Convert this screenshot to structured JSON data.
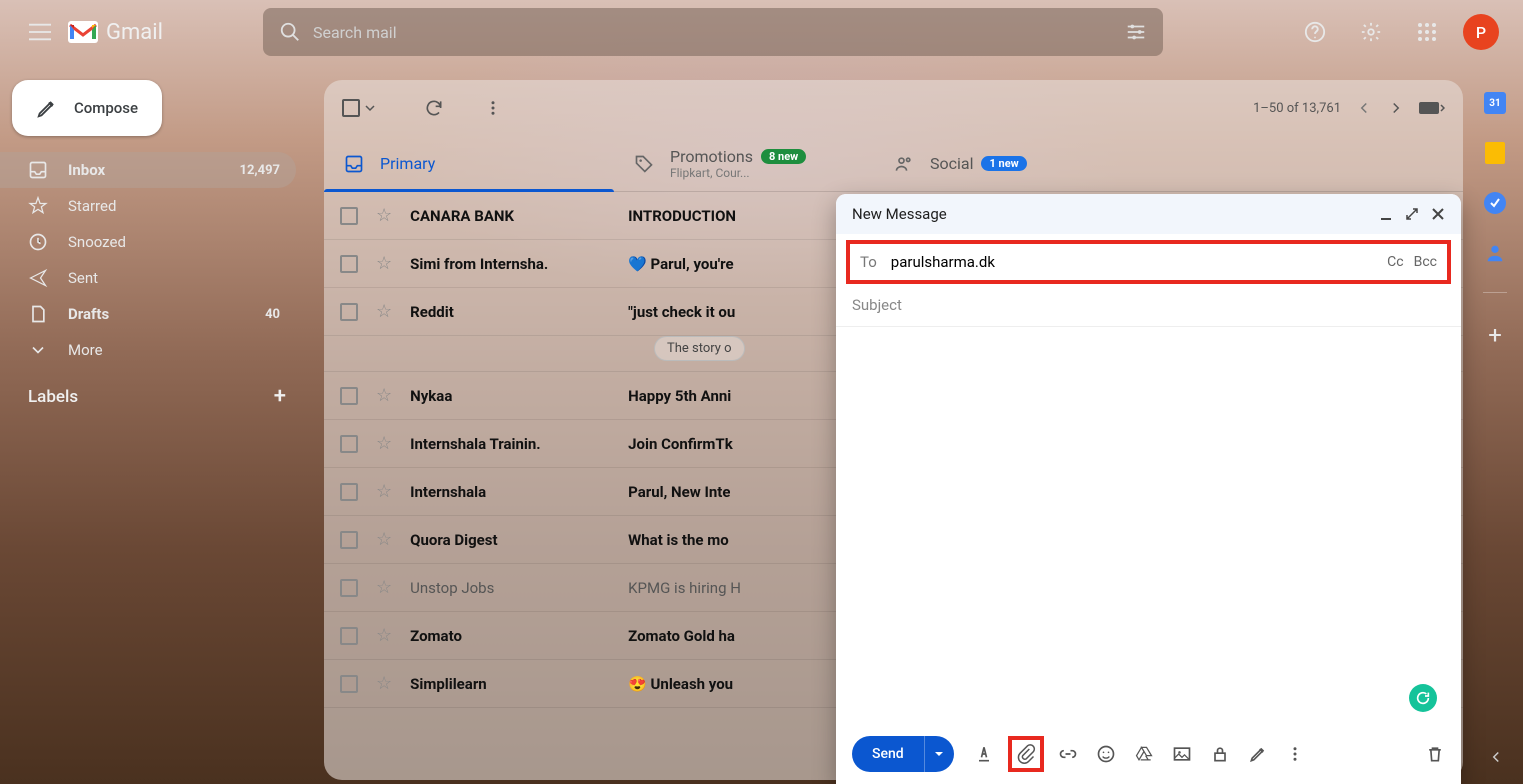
{
  "header": {
    "app_name": "Gmail",
    "search_placeholder": "Search mail",
    "avatar_initial": "P"
  },
  "compose_button_label": "Compose",
  "sidebar": {
    "items": [
      {
        "label": "Inbox",
        "count": "12,497"
      },
      {
        "label": "Starred",
        "count": ""
      },
      {
        "label": "Snoozed",
        "count": ""
      },
      {
        "label": "Sent",
        "count": ""
      },
      {
        "label": "Drafts",
        "count": "40"
      },
      {
        "label": "More",
        "count": ""
      }
    ],
    "labels_header": "Labels"
  },
  "toolbar": {
    "range": "1–50 of 13,761"
  },
  "tabs": {
    "primary": "Primary",
    "promotions": {
      "label": "Promotions",
      "badge": "8 new",
      "sub": "Flipkart, Cour..."
    },
    "social": {
      "label": "Social",
      "badge": "1 new"
    }
  },
  "emails": [
    {
      "sender": "CANARA BANK",
      "subject": "INTRODUCTION",
      "unread": true
    },
    {
      "sender": "Simi from Internsha.",
      "subject": "💙 Parul, you're",
      "unread": true
    },
    {
      "sender": "Reddit",
      "subject": "\"just check it ou",
      "unread": true,
      "chip": "The story o"
    },
    {
      "sender": "Nykaa",
      "subject": "Happy 5th Anni",
      "unread": true
    },
    {
      "sender": "Internshala Trainin.",
      "subject": "Join ConfirmTk",
      "unread": true
    },
    {
      "sender": "Internshala",
      "subject": "Parul, New Inte",
      "unread": true
    },
    {
      "sender": "Quora Digest",
      "subject": "What is the mo",
      "unread": true
    },
    {
      "sender": "Unstop Jobs",
      "subject": "KPMG is hiring H",
      "unread": false
    },
    {
      "sender": "Zomato",
      "subject": "Zomato Gold ha",
      "unread": true
    },
    {
      "sender": "Simplilearn",
      "subject": "😍 Unleash you",
      "unread": true
    }
  ],
  "compose": {
    "title": "New Message",
    "to_label": "To",
    "to_value": "parulsharma.dk",
    "cc": "Cc",
    "bcc": "Bcc",
    "subject_placeholder": "Subject",
    "send_label": "Send"
  }
}
